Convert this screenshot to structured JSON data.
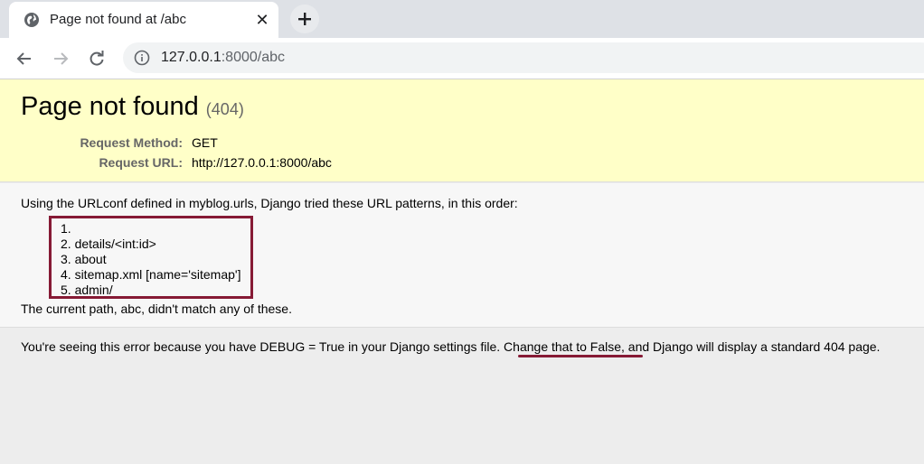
{
  "browser": {
    "tab_title": "Page not found at /abc",
    "close_glyph": "✕",
    "new_tab_glyph": "+",
    "url_host": "127.0.0.1",
    "url_rest": ":8000/abc"
  },
  "summary": {
    "title": "Page not found",
    "code": "(404)",
    "request_method_label": "Request Method:",
    "request_method_value": "GET",
    "request_url_label": "Request URL:",
    "request_url_value": "http://127.0.0.1:8000/abc"
  },
  "info": {
    "intro": "Using the URLconf defined in myblog.urls, Django tried these URL patterns, in this order:",
    "patterns": [
      "1.",
      "2. details/<int:id>",
      "3. about",
      "4. sitemap.xml [name='sitemap']",
      "5. admin/"
    ],
    "footer": "The current path, abc, didn't match any of these."
  },
  "explanation": {
    "text": "You're seeing this error because you have DEBUG = True in your Django settings file. Change that to False, and Django will display a standard 404 page."
  },
  "colors": {
    "summary_bg": "#ffffc8",
    "highlight": "#861a35"
  }
}
